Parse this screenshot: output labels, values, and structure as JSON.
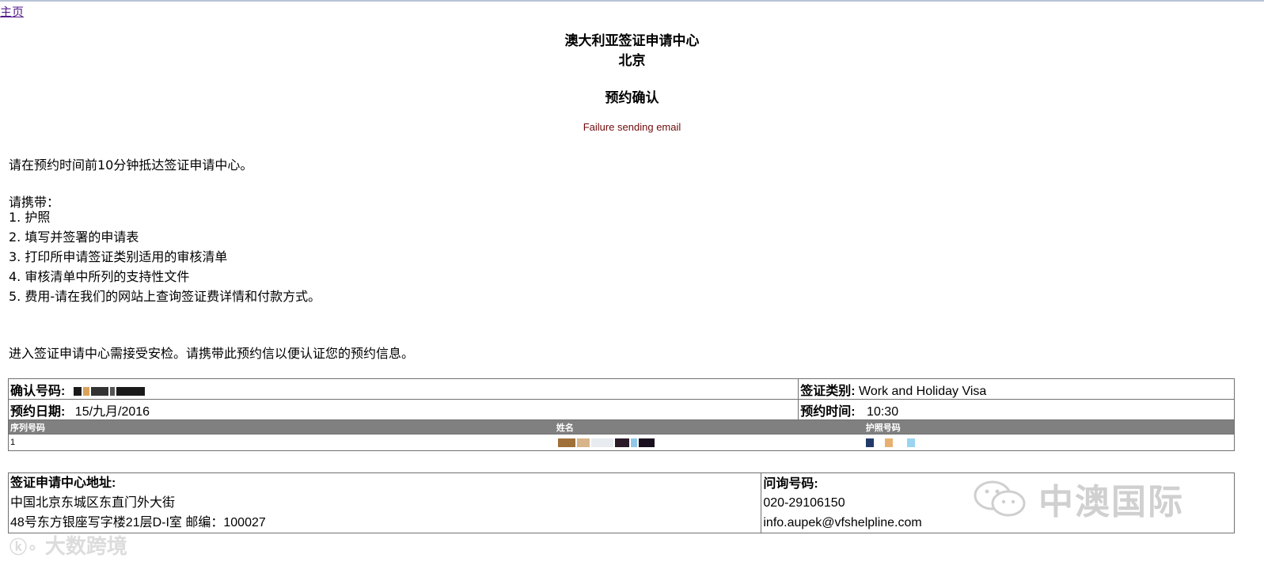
{
  "nav": {
    "home_link": "主页"
  },
  "header": {
    "line1": "澳大利亚签证申请中心",
    "line2": "北京",
    "title": "预约确认",
    "error": "Failure sending email"
  },
  "instructions": {
    "arrival": "请在预约时间前10分钟抵达签证申请中心。",
    "bring_heading": "请携带：",
    "items": [
      "1. 护照",
      "2. 填写并签署的申请表",
      "3. 打印所申请签证类别适用的审核清单",
      "4. 审核清单中所列的支持性文件",
      "5. 费用-请在我们的网站上查询签证费详情和付款方式。"
    ],
    "security": "进入签证申请中心需接受安检。请携带此预约信以便认证您的预约信息。"
  },
  "booking": {
    "confirmation_label": "确认号码:",
    "visa_type_label": "签证类别:",
    "visa_type_value": "Work and Holiday Visa",
    "date_label": "预约日期:",
    "date_value": "15/九月/2016",
    "time_label": "预约时间:",
    "time_value": "10:30",
    "columns": [
      "序列号码",
      "姓名",
      "护照号码"
    ],
    "rows": [
      {
        "seq": "1"
      }
    ]
  },
  "centre": {
    "address_label": "签证申请中心地址:",
    "address_line1": "中国北京东城区东直门外大街",
    "address_line2": "48号东方银座写字楼21层D-I室 邮编：100027",
    "enquiry_label": "问询号码:",
    "phone": "020-29106150",
    "email": "info.aupek@vfshelpline.com"
  },
  "watermarks": {
    "brand_cn": "中澳国际",
    "bottom": "大数跨境"
  },
  "colors": {
    "error_text": "#6e0b0b",
    "table_header_bg": "#808080",
    "link": "#551a8b"
  }
}
